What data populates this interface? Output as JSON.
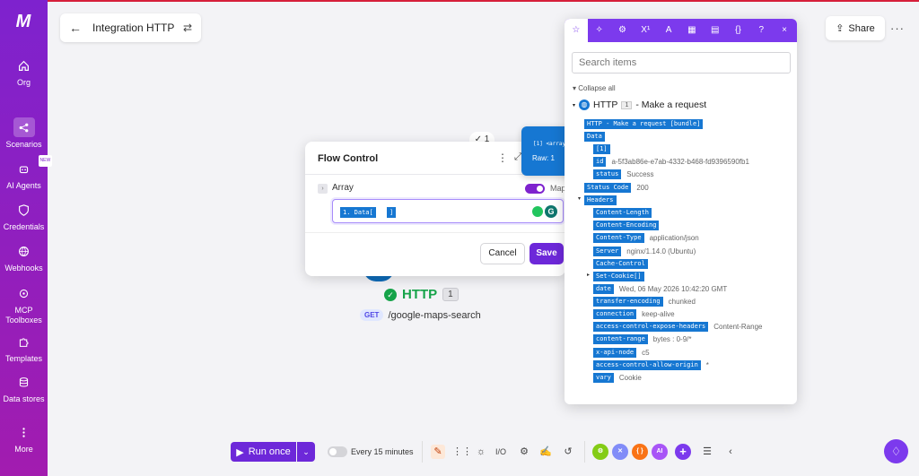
{
  "colors": {
    "sidebar": "#7e22ce",
    "accent": "#6d28d9",
    "http_green": "#16a34a",
    "pill_blue": "#1677d2"
  },
  "sidebar": {
    "logo": "M",
    "items": [
      {
        "label": "Org",
        "icon": "home-icon"
      },
      {
        "label": "Scenarios",
        "icon": "share-icon"
      },
      {
        "label": "AI Agents",
        "icon": "robot-icon",
        "tag": "NEW"
      },
      {
        "label": "Credentials",
        "icon": "shield-icon"
      },
      {
        "label": "Webhooks",
        "icon": "globe-icon"
      },
      {
        "label": "MCP Toolboxes",
        "icon": "mcp-icon"
      },
      {
        "label": "Templates",
        "icon": "puzzle-icon"
      },
      {
        "label": "Data stores",
        "icon": "database-icon"
      },
      {
        "label": "More",
        "icon": "more-icon"
      }
    ]
  },
  "header": {
    "title": "Integration HTTP",
    "share_label": "Share"
  },
  "canvas": {
    "top_badge": "✓ 1",
    "node": {
      "name": "HTTP",
      "count": "1",
      "method": "GET",
      "route": "/google-maps-search"
    }
  },
  "flow_control": {
    "title": "Flow Control",
    "field_label": "Array",
    "map_label": "Map",
    "pill_1": "1. Data[",
    "pill_2": "]",
    "cancel_label": "Cancel",
    "save_label": "Save"
  },
  "tooltip": {
    "line1": "[1] <array>",
    "line2": "Raw: 1"
  },
  "mapping_panel": {
    "search_placeholder": "Search items",
    "collapse_all": "Collapse all",
    "root": {
      "name": "HTTP",
      "count": "1",
      "suffix": "- Make a request"
    },
    "rows": [
      {
        "key": "HTTP - Make a request [bundle]",
        "value": ""
      },
      {
        "key": "Data",
        "value": ""
      },
      {
        "key": "[1]",
        "value": ""
      },
      {
        "key": "id",
        "value": "a-5f3ab86e-e7ab-4332-b468-fd9396590fb1"
      },
      {
        "key": "status",
        "value": "Success"
      },
      {
        "key": "Status Code",
        "value": "200"
      },
      {
        "key": "Headers",
        "value": ""
      },
      {
        "key": "Content-Length",
        "value": ""
      },
      {
        "key": "Content-Encoding",
        "value": ""
      },
      {
        "key": "Content-Type",
        "value": "application/json"
      },
      {
        "key": "Server",
        "value": "nginx/1.14.0 (Ubuntu)"
      },
      {
        "key": "Cache-Control",
        "value": ""
      },
      {
        "key": "Set-Cookie[]",
        "value": ""
      },
      {
        "key": "date",
        "value": "Wed, 06 May 2026 10:42:20 GMT"
      },
      {
        "key": "transfer-encoding",
        "value": "chunked"
      },
      {
        "key": "connection",
        "value": "keep-alive"
      },
      {
        "key": "access-control-expose-headers",
        "value": "Content-Range"
      },
      {
        "key": "content-range",
        "value": "bytes : 0-9/*"
      },
      {
        "key": "x-api-node",
        "value": "c5"
      },
      {
        "key": "access-control-allow-origin",
        "value": "*"
      },
      {
        "key": "vary",
        "value": "Cookie"
      }
    ]
  },
  "toolbar": {
    "run_label": "Run once",
    "schedule_label": "Every 15 minutes",
    "io_label": "I/O",
    "circle_ai": "AI",
    "circle_brackets": "{ }"
  }
}
